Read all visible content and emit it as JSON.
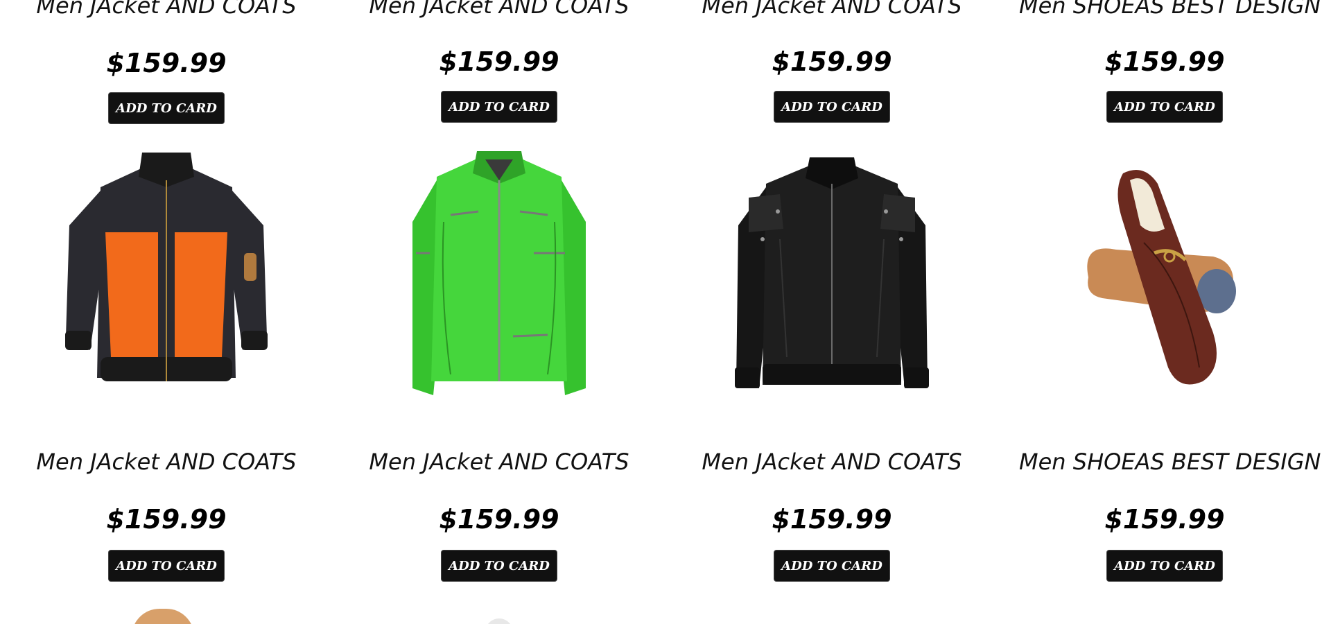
{
  "top_row": [
    {
      "title": "Men JAcket AND COATS",
      "price": "$159.99",
      "button": "ADD TO CARD"
    },
    {
      "title": "Men JAcket AND COATS",
      "price": "$159.99",
      "button": "ADD TO CARD"
    },
    {
      "title": "Men JAcket AND COATS",
      "price": "$159.99",
      "button": "ADD TO CARD"
    },
    {
      "title": "Men SHOEAS BEST DESIGN",
      "price": "$159.99",
      "button": "ADD TO CARD"
    }
  ],
  "products": [
    {
      "image": "orange-black-jacket",
      "title": "Men JAcket AND COATS",
      "price": "$159.99",
      "button": "ADD TO CARD",
      "colors": {
        "primary": "#2a2a30",
        "accent": "#f26a1b"
      }
    },
    {
      "image": "green-leather-jacket",
      "title": "Men JAcket AND COATS",
      "price": "$159.99",
      "button": "ADD TO CARD",
      "colors": {
        "primary": "#3fcf37",
        "accent": "#2a8f25"
      }
    },
    {
      "image": "black-leather-jacket",
      "title": "Men JAcket AND COATS",
      "price": "$159.99",
      "button": "ADD TO CARD",
      "colors": {
        "primary": "#1c1c1c",
        "accent": "#555555"
      }
    },
    {
      "image": "brown-loafer-shoes",
      "title": "Men SHOEAS BEST DESIGN",
      "price": "$159.99",
      "button": "ADD TO CARD",
      "colors": {
        "primary": "#6b2a1f",
        "accent": "#c98a55"
      }
    }
  ],
  "colors": {
    "button_bg": "#111111",
    "button_text": "#ffffff",
    "text": "#111111"
  }
}
